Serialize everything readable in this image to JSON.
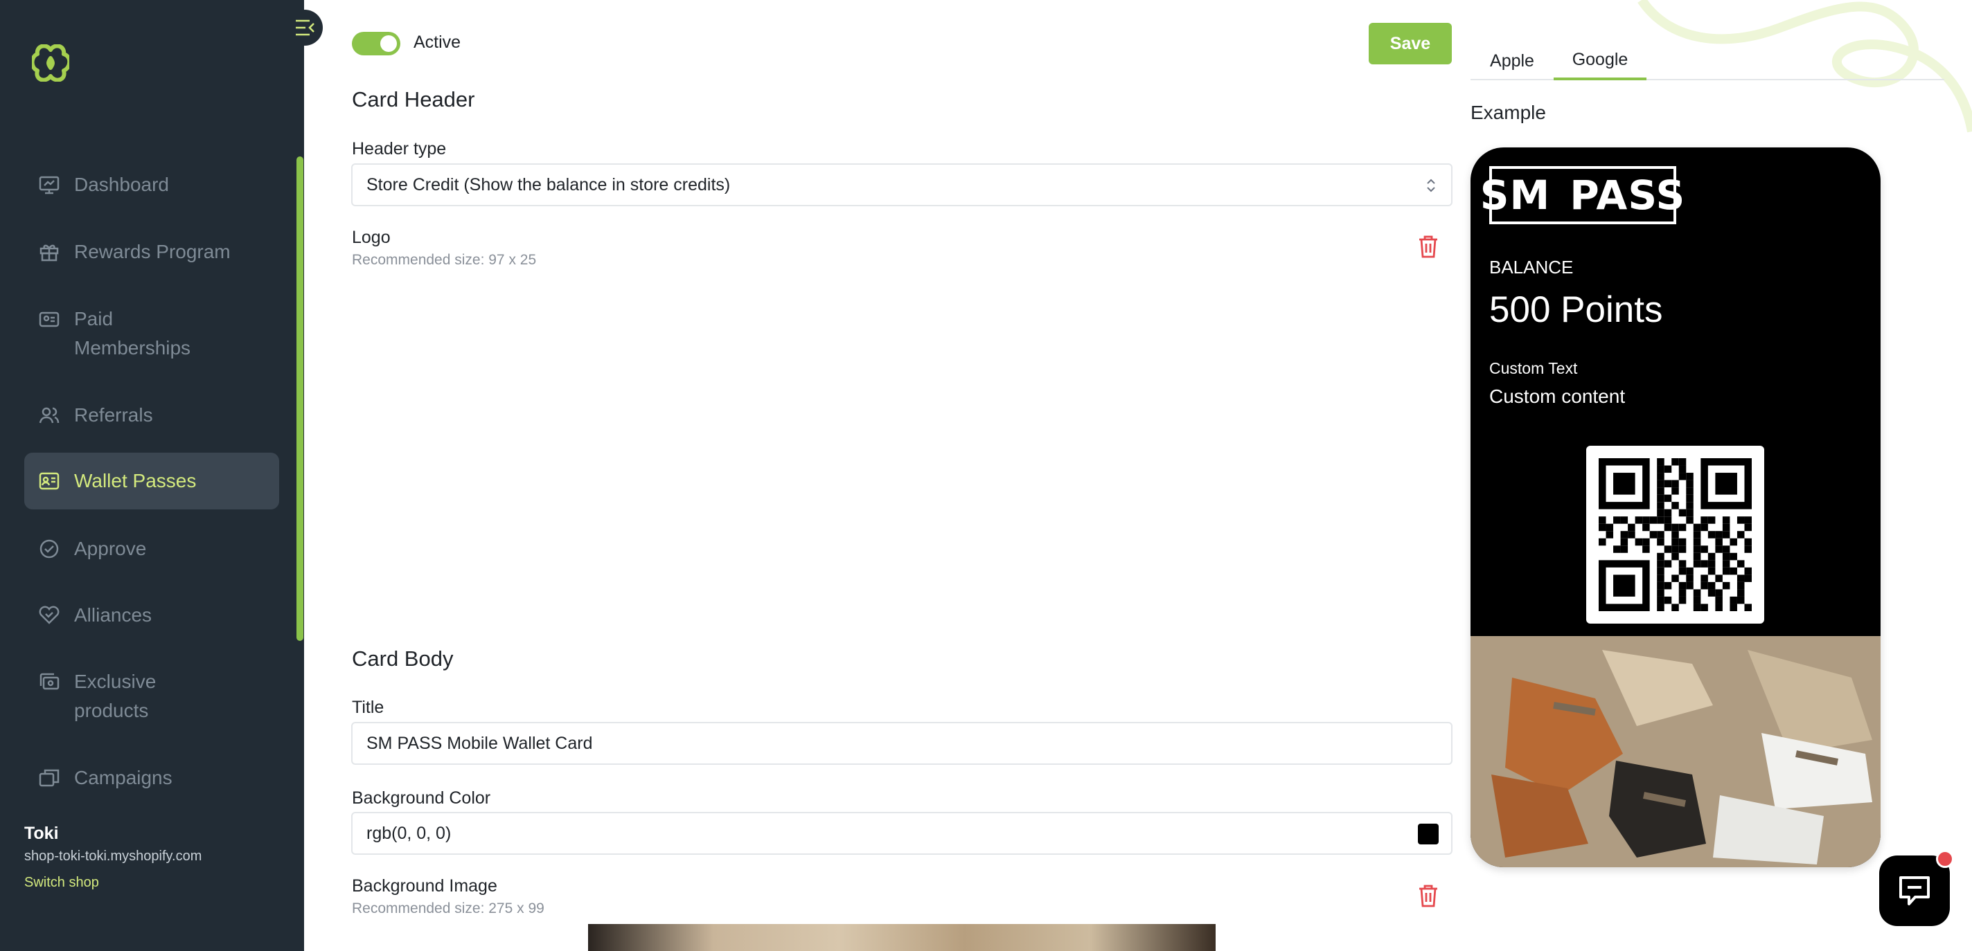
{
  "sidebar": {
    "logo_icon": "brand-logo-icon",
    "items": [
      {
        "label": "Dashboard",
        "icon": "dashboard-icon"
      },
      {
        "label": "Rewards Program",
        "icon": "gift-icon"
      },
      {
        "label": "Paid Memberships",
        "icon": "membership-card-icon"
      },
      {
        "label": "Referrals",
        "icon": "users-icon"
      },
      {
        "label": "Wallet Passes",
        "icon": "id-card-icon",
        "active": true
      },
      {
        "label": "Approve",
        "icon": "check-circle-icon"
      },
      {
        "label": "Alliances",
        "icon": "heart-handshake-icon"
      },
      {
        "label": "Exclusive products",
        "icon": "exclusive-products-icon"
      },
      {
        "label": "Campaigns",
        "icon": "campaign-icon"
      }
    ],
    "shop": {
      "name": "Toki",
      "domain": "shop-toki-toki.myshopify.com",
      "switch_label": "Switch shop"
    }
  },
  "form": {
    "active_label": "Active",
    "active_on": true,
    "save_label": "Save",
    "card_header_title": "Card Header",
    "header_type_label": "Header type",
    "header_type_value": "Store Credit (Show the balance in store credits)",
    "logo_label": "Logo",
    "logo_hint": "Recommended size: 97 x 25",
    "card_body_title": "Card Body",
    "title_label": "Title",
    "title_value": "SM PASS Mobile Wallet Card",
    "bg_color_label": "Background Color",
    "bg_color_value": "rgb(0, 0, 0)",
    "bg_image_label": "Background Image",
    "bg_image_hint": "Recommended size: 275 x 99"
  },
  "preview": {
    "tabs": [
      "Apple",
      "Google"
    ],
    "active_tab": "Google",
    "example_label": "Example",
    "card": {
      "logo_left": "SM",
      "logo_right": "PASS",
      "balance_label": "BALANCE",
      "balance_value": "500 Points",
      "custom_label": "Custom Text",
      "custom_value": "Custom content"
    }
  },
  "colors": {
    "accent": "#8bc34a",
    "sidebar_bg": "#222c35",
    "sidebar_active_text": "#d4ea7e",
    "danger": "#e5484d"
  }
}
